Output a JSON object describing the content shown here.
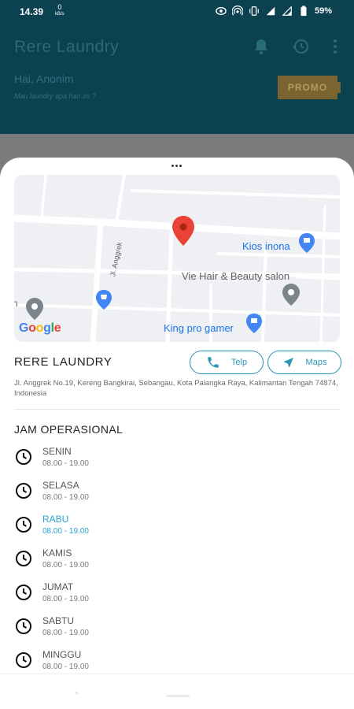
{
  "status_bar": {
    "time": "14.39",
    "speed_value": "0",
    "speed_unit": "kB/s",
    "battery": "59%"
  },
  "app": {
    "title": "Rere Laundry",
    "greeting": "Hai, Anonim",
    "subtitle": "Mau laundry apa hari ini ?",
    "promo_label": "PROMO"
  },
  "map": {
    "labels": {
      "kios": "Kios inona",
      "vie": "Vie Hair & Beauty salon",
      "king": "King pro gamer",
      "street": "Jl. Anggrek",
      "edge": "n\ni",
      "google": [
        "G",
        "o",
        "o",
        "g",
        "l",
        "e"
      ]
    }
  },
  "shop": {
    "name": "RERE LAUNDRY",
    "address": "Jl. Anggrek No.19, Kereng Bangkirai, Sebangau, Kota Palangka Raya, Kalimantan Tengah 74874, Indonesia",
    "telp_label": "Telp",
    "maps_label": "Maps"
  },
  "hours": {
    "title": "JAM OPERASIONAL",
    "days": [
      {
        "day": "SENIN",
        "time": "08.00 - 19.00"
      },
      {
        "day": "SELASA",
        "time": "08.00 - 19.00"
      },
      {
        "day": "RABU",
        "time": "08.00 - 19.00"
      },
      {
        "day": "KAMIS",
        "time": "08.00 - 19.00"
      },
      {
        "day": "JUMAT",
        "time": "08.00 - 19.00"
      },
      {
        "day": "SABTU",
        "time": "08.00 - 19.00"
      },
      {
        "day": "MINGGU",
        "time": "08.00 - 19.00"
      }
    ]
  },
  "colors": {
    "header": "#0c4150",
    "accent": "#2b97b5",
    "today": "#29a3d1",
    "pin": "#ea4335"
  }
}
